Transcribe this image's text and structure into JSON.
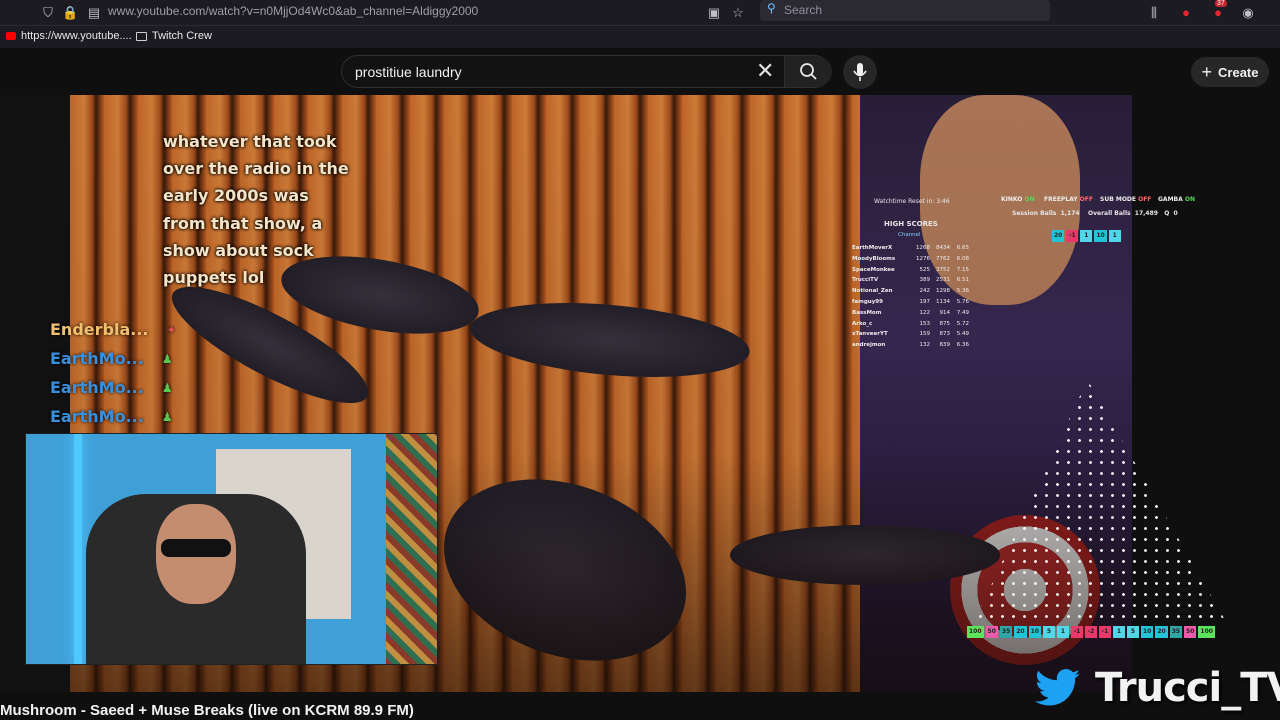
{
  "browser": {
    "url": "www.youtube.com/watch?v=n0MjjOd4Wc0&ab_channel=Aldiggy2000",
    "search_placeholder": "Search",
    "bookmarks": [
      "https://www.youtube....",
      "Twitch Crew"
    ],
    "badge_count": "37"
  },
  "youtube": {
    "search_value": "prostitiue laundry",
    "create_label": "Create",
    "video_title": "Mushroom - Saeed + Muse Breaks (live on KCRM 89.9 FM)"
  },
  "chat": {
    "message": "whatever that took over the radio in the early 2000s was from that show, a show about sock puppets lol",
    "names": [
      "Enderbla...",
      "EarthMo...",
      "EarthMo...",
      "EarthMo..."
    ]
  },
  "overlay": {
    "watchtime": "Watchtime Reset in: 3:46",
    "high_scores_title": "HIGH SCORES",
    "high_scores_sub": "Channel",
    "flags": [
      {
        "label": "KINKO",
        "state": "ON"
      },
      {
        "label": "FREEPLAY",
        "state": "OFF"
      },
      {
        "label": "SUB MODE",
        "state": "OFF"
      },
      {
        "label": "GAMBA",
        "state": "ON"
      }
    ],
    "session_balls_label": "Session Balls",
    "session_balls": "1,174",
    "overall_balls_label": "Overall Balls",
    "overall_balls": "17,489",
    "q_label": "Q",
    "q_value": "0",
    "scores": [
      {
        "name": "EarthMoverX",
        "a": "1268",
        "b": "8434",
        "c": "6.65"
      },
      {
        "name": "MoodyBlooms",
        "a": "1276",
        "b": "7762",
        "c": "6.08"
      },
      {
        "name": "SpaceMonkee",
        "a": "525",
        "b": "3752",
        "c": "7.15"
      },
      {
        "name": "TrucciTV",
        "a": "389",
        "b": "2531",
        "c": "6.51"
      },
      {
        "name": "Notional_Zen",
        "a": "242",
        "b": "1298",
        "c": "5.36"
      },
      {
        "name": "famguy99",
        "a": "197",
        "b": "1134",
        "c": "5.76"
      },
      {
        "name": "BassMom",
        "a": "122",
        "b": "914",
        "c": "7.49"
      },
      {
        "name": "Arko_c",
        "a": "153",
        "b": "875",
        "c": "5.72"
      },
      {
        "name": "xTanveerYT",
        "a": "159",
        "b": "873",
        "c": "5.49"
      },
      {
        "name": "andrejmon",
        "a": "132",
        "b": "839",
        "c": "6.36"
      }
    ],
    "top_chips": [
      {
        "v": "20",
        "c": "#22c4d8"
      },
      {
        "v": "-1",
        "c": "#e83a6a"
      },
      {
        "v": "1",
        "c": "#52d7e8"
      },
      {
        "v": "10",
        "c": "#22c4d8"
      },
      {
        "v": "1",
        "c": "#52d7e8"
      }
    ],
    "bottom_chips": [
      {
        "v": "100",
        "c": "#5ee35e"
      },
      {
        "v": "50",
        "c": "#f05aa8"
      },
      {
        "v": "35",
        "c": "#2fa6a6"
      },
      {
        "v": "20",
        "c": "#22c4d8"
      },
      {
        "v": "10",
        "c": "#22c4d8"
      },
      {
        "v": "5",
        "c": "#52d7e8"
      },
      {
        "v": "1",
        "c": "#52d7e8"
      },
      {
        "v": "-1",
        "c": "#e83a6a"
      },
      {
        "v": "-2",
        "c": "#e83a6a"
      },
      {
        "v": "-1",
        "c": "#e83a6a"
      },
      {
        "v": "1",
        "c": "#52d7e8"
      },
      {
        "v": "5",
        "c": "#52d7e8"
      },
      {
        "v": "10",
        "c": "#22c4d8"
      },
      {
        "v": "20",
        "c": "#22c4d8"
      },
      {
        "v": "35",
        "c": "#2fa6a6"
      },
      {
        "v": "50",
        "c": "#f05aa8"
      },
      {
        "v": "100",
        "c": "#5ee35e"
      }
    ]
  },
  "brand": {
    "name": "Trucci_TV"
  }
}
